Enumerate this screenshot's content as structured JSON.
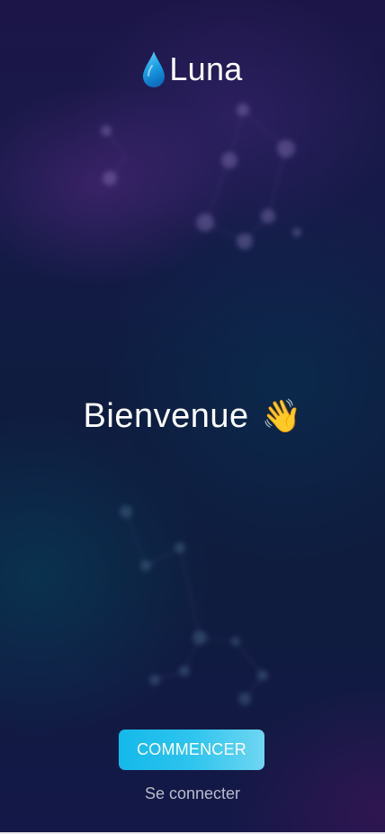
{
  "app": {
    "name": "Luna",
    "logo_icon": "water-drop-icon"
  },
  "welcome": {
    "title": "Bienvenue",
    "emoji": "👋",
    "emoji_icon": "waving-hand-icon"
  },
  "actions": {
    "start_label": "COMMENCER",
    "login_label": "Se connecter"
  },
  "colors": {
    "accent": "#14b9ea",
    "accent_light": "#6fd6f2",
    "background_top": "#1c1648",
    "background_bottom": "#141848",
    "muted_text": "#b8bccb"
  }
}
